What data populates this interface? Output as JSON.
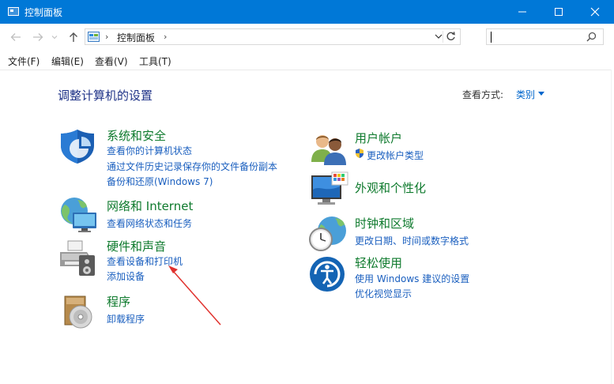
{
  "window": {
    "title": "控制面板"
  },
  "address": {
    "breadcrumb": "控制面板",
    "search_placeholder": ""
  },
  "menu": {
    "file": "文件(F)",
    "edit": "编辑(E)",
    "view": "查看(V)",
    "tools": "工具(T)"
  },
  "content": {
    "heading": "调整计算机的设置",
    "view_by_label": "查看方式:",
    "view_by_value": "类别"
  },
  "categories_left": [
    {
      "title": "系统和安全",
      "icon": "shield-icon",
      "links": [
        "查看你的计算机状态",
        "通过文件历史记录保存你的文件备份副本",
        "备份和还原(Windows 7)"
      ]
    },
    {
      "title": "网络和 Internet",
      "icon": "network-globe-icon",
      "links": [
        "查看网络状态和任务"
      ]
    },
    {
      "title": "硬件和声音",
      "icon": "printer-speaker-icon",
      "links": [
        "查看设备和打印机",
        "添加设备"
      ]
    },
    {
      "title": "程序",
      "icon": "programs-disc-icon",
      "links": [
        "卸载程序"
      ]
    }
  ],
  "categories_right": [
    {
      "title": "用户帐户",
      "icon": "users-icon",
      "links": [
        "更改帐户类型"
      ]
    },
    {
      "title": "外观和个性化",
      "icon": "monitor-palette-icon",
      "links": []
    },
    {
      "title": "时钟和区域",
      "icon": "clock-globe-icon",
      "links": [
        "更改日期、时间或数字格式"
      ]
    },
    {
      "title": "轻松使用",
      "icon": "ease-of-access-icon",
      "links": [
        "使用 Windows 建议的设置",
        "优化视觉显示"
      ]
    }
  ],
  "colors": {
    "titlebar": "#0078d7",
    "category_title": "#0e7a2d",
    "link": "#1a5fbf",
    "heading": "#1e3287",
    "annotation_arrow": "#e0322e"
  }
}
